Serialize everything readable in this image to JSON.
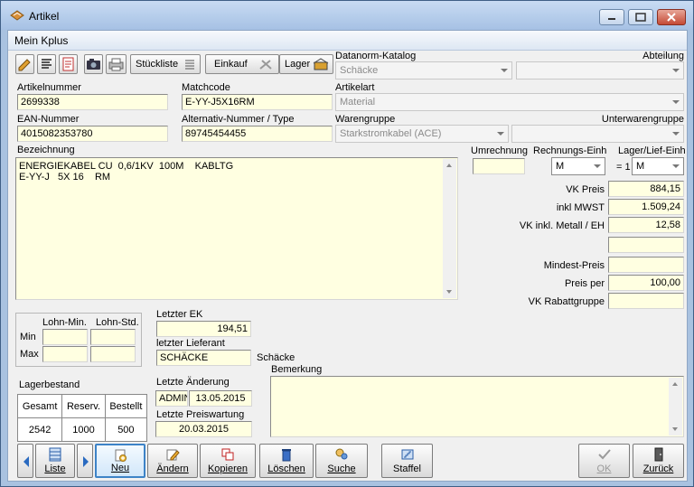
{
  "window": {
    "title": "Artikel"
  },
  "menu": {
    "item": "Mein Kplus"
  },
  "toolbar": {
    "stueckliste": "Stückliste",
    "einkauf": "Einkauf",
    "lager": "Lager"
  },
  "datanorm": {
    "label": "Datanorm-Katalog",
    "value": "Schäcke"
  },
  "abteilung": {
    "label": "Abteilung",
    "value": ""
  },
  "artikelnummer": {
    "label": "Artikelnummer",
    "value": "2699338"
  },
  "matchcode": {
    "label": "Matchcode",
    "value": "E-YY-J5X16RM"
  },
  "artikelart": {
    "label": "Artikelart",
    "value": "Material"
  },
  "ean": {
    "label": "EAN-Nummer",
    "value": "4015082353780"
  },
  "alternativ": {
    "label": "Alternativ-Nummer / Type",
    "value": "89745454455"
  },
  "warengruppe": {
    "label": "Warengruppe",
    "value": "Starkstromkabel (ACE)"
  },
  "unterwarengruppe": {
    "label": "Unterwarengruppe",
    "value": ""
  },
  "bezeichnung": {
    "label": "Bezeichnung",
    "line1": "ENERGIEKABEL CU  0,6/1KV  100M    KABLTG",
    "line2": "E-YY-J   5X 16    RM"
  },
  "umrechnung": {
    "label": "Umrechnung",
    "value": ""
  },
  "rechnungs_einh": {
    "label": "Rechnungs-Einh",
    "value": "M"
  },
  "lager_lief_einh": {
    "label": "Lager/Lief-Einh",
    "prefix": "= 1",
    "value": "M"
  },
  "prices": {
    "vk_preis_label": "VK Preis",
    "vk_preis": "884,15",
    "inkl_mwst_label": "inkl MWST",
    "inkl_mwst": "1.509,24",
    "vk_metall_label": "VK inkl. Metall / EH",
    "vk_metall": "12,58",
    "extra": "",
    "mindest_label": "Mindest-Preis",
    "mindest": "",
    "preis_per_label": "Preis per",
    "preis_per": "100,00",
    "rabatt_label": "VK Rabattgruppe",
    "rabatt": ""
  },
  "lohn": {
    "min_label": "Lohn-Min.",
    "std_label": "Lohn-Std.",
    "row_min": "Min",
    "row_max": "Max"
  },
  "letzter_ek": {
    "label": "Letzter EK",
    "value": "194,51"
  },
  "letzter_lieferant": {
    "label": "letzter Lieferant",
    "value": "SCHÄCKE",
    "name": "Schäcke"
  },
  "lagerbestand": {
    "label": "Lagerbestand",
    "headers": [
      "Gesamt",
      "Reserv.",
      "Bestellt"
    ],
    "values": [
      "2542",
      "1000",
      "500"
    ]
  },
  "letzte_aenderung": {
    "label": "Letzte Änderung",
    "user": "ADMIN",
    "date": "13.05.2015"
  },
  "letzte_preiswartung": {
    "label": "Letzte Preiswartung",
    "date": "20.03.2015"
  },
  "bemerkung": {
    "label": "Bemerkung",
    "value": ""
  },
  "buttons": {
    "liste": "Liste",
    "neu": "Neu",
    "aendern": "Ändern",
    "kopieren": "Kopieren",
    "loeschen": "Löschen",
    "suche": "Suche",
    "staffel": "Staffel",
    "ok": "OK",
    "zurueck": "Zurück"
  }
}
